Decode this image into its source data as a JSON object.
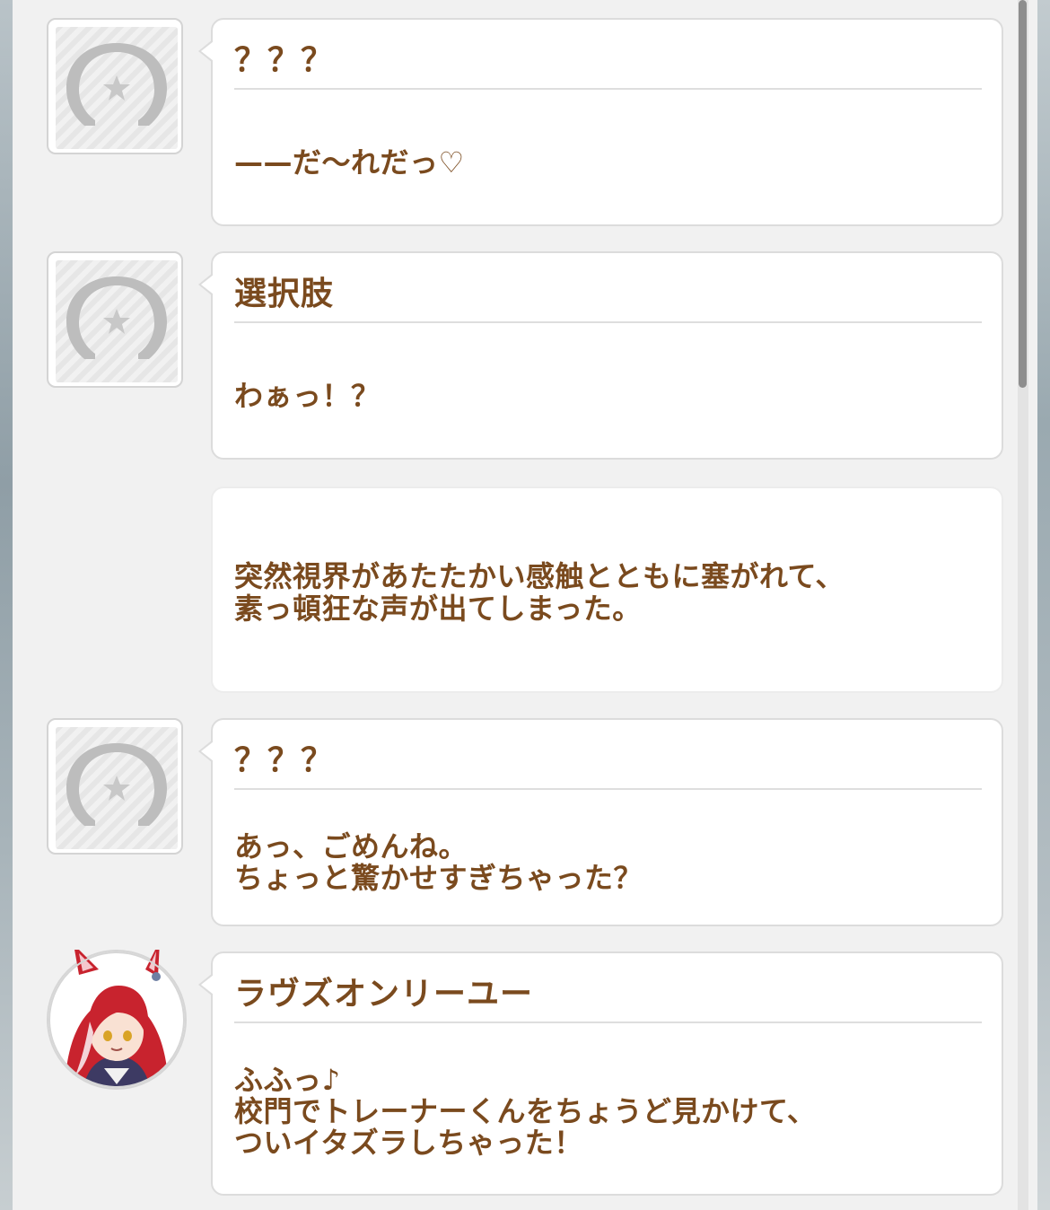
{
  "messages": [
    {
      "speaker": "？？？",
      "text": "——だ～れだっ♡",
      "avatar": "horseshoe-placeholder-icon"
    },
    {
      "speaker": "選択肢",
      "text": "わぁっ！？",
      "avatar": "horseshoe-placeholder-icon"
    },
    {
      "speaker": "",
      "text": "突然視界があたたかい感触とともに塞がれて、\n素っ頓狂な声が出てしまった。",
      "avatar": ""
    },
    {
      "speaker": "？？？",
      "text": "あっ、ごめんね。\nちょっと驚かせすぎちゃった？",
      "avatar": "horseshoe-placeholder-icon"
    },
    {
      "speaker": "ラヴズオンリーユー",
      "text": "ふふっ♪\n校門でトレーナーくんをちょうど見かけて、\nついイタズラしちゃった！",
      "avatar": "character-portrait"
    }
  ],
  "colors": {
    "text": "#7a4a1e",
    "panel": "#f1f1f1",
    "bubble": "#ffffff",
    "character_hair": "#c8232e"
  }
}
